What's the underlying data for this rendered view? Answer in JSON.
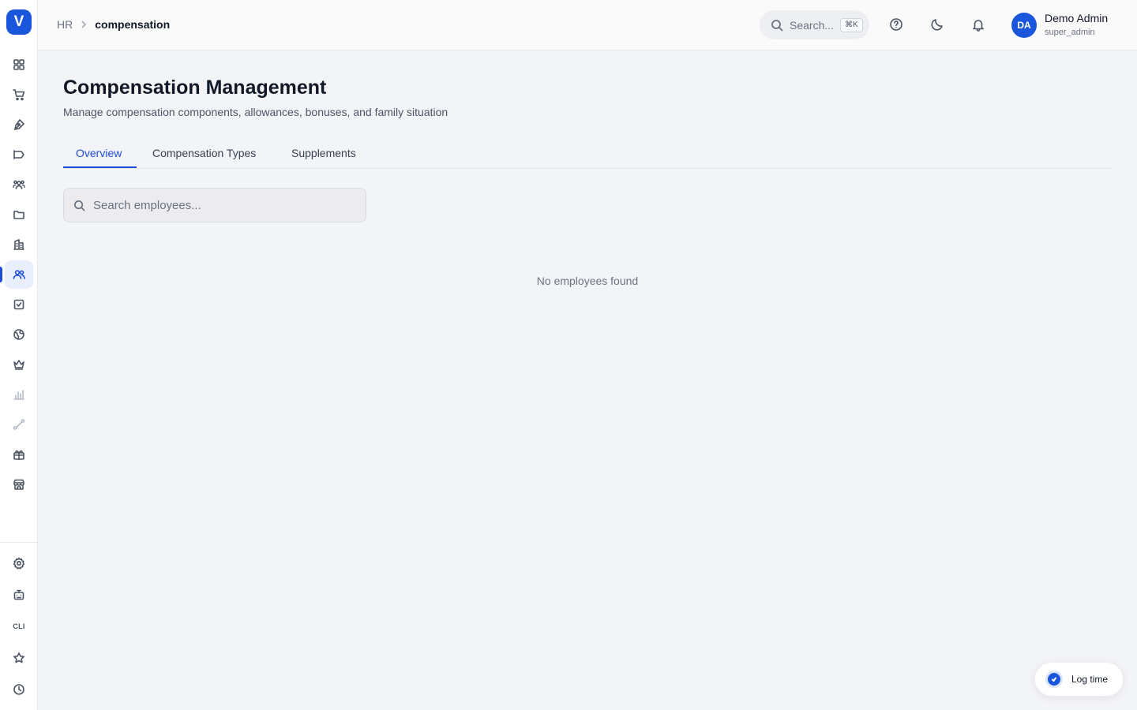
{
  "app": {
    "logo_letter": "V"
  },
  "sidebar": {
    "items": [
      {
        "name": "dashboard-icon"
      },
      {
        "name": "shopping-cart-icon"
      },
      {
        "name": "pen-tool-icon"
      },
      {
        "name": "megaphone-icon"
      },
      {
        "name": "team-icon"
      },
      {
        "name": "folder-icon"
      },
      {
        "name": "building-icon"
      },
      {
        "name": "users-icon",
        "active": true
      },
      {
        "name": "checkbox-icon"
      },
      {
        "name": "globe-icon"
      },
      {
        "name": "crown-icon"
      },
      {
        "name": "bar-chart-icon"
      },
      {
        "name": "route-icon"
      },
      {
        "name": "gift-icon"
      },
      {
        "name": "store-icon"
      }
    ],
    "bottom": [
      {
        "name": "settings-icon"
      },
      {
        "name": "bot-icon"
      },
      {
        "name": "cli",
        "label": "CLI"
      },
      {
        "name": "star-icon"
      },
      {
        "name": "clock-icon"
      }
    ]
  },
  "header": {
    "breadcrumb": {
      "root": "HR",
      "current": "compensation"
    },
    "search": {
      "placeholder": "Search...",
      "shortcut": "⌘K"
    },
    "user": {
      "initials": "DA",
      "name": "Demo Admin",
      "role": "super_admin"
    }
  },
  "main": {
    "title": "Compensation Management",
    "subtitle": "Manage compensation components, allowances, bonuses, and family situation",
    "tabs": [
      {
        "label": "Overview",
        "active": true
      },
      {
        "label": "Compensation Types"
      },
      {
        "label": "Supplements"
      }
    ],
    "employee_search": {
      "placeholder": "Search employees..."
    },
    "empty_message": "No employees found"
  },
  "log_time": {
    "label": "Log time"
  },
  "colors": {
    "accent": "#1a56db",
    "background": "#f3f4f7"
  }
}
